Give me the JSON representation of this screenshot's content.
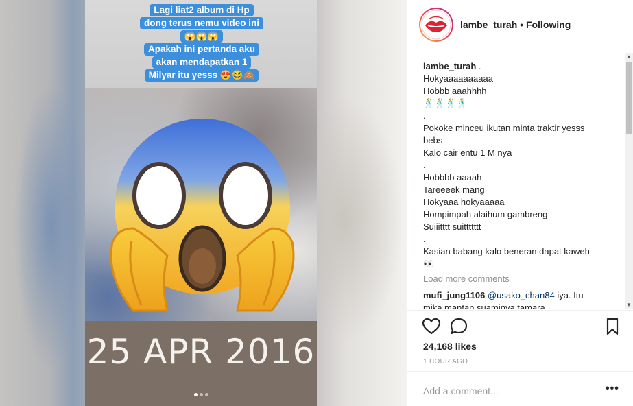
{
  "post": {
    "story": {
      "caption_lines": [
        "Lagi liat2 album di Hp",
        "dong terus nemu video ini",
        "😱😱😱",
        "Apakah ini pertanda aku",
        "akan mendapatkan 1",
        "Milyar itu yesss 😍😂🙈"
      ],
      "date_text": "25 APR 2016",
      "emoji_name": "scream-emoji"
    },
    "header": {
      "username": "lambe_turah",
      "separator": " • ",
      "follow_label": "Following"
    },
    "comments": {
      "owner": "lambe_turah",
      "caption_lines": [
        " .",
        "Hokyaaaaaaaaaa",
        "Hobbb aaahhhh",
        "🕺🕺🕺🕺",
        ".",
        "Pokoke minceu ikutan minta traktir yesss",
        "bebs",
        "Kalo cair entu 1 M nya",
        ".",
        "Hobbbb aaaah",
        "Tareeeek mang",
        "Hokyaaa hokyaaaaa",
        "Hompimpah alaihum gambreng",
        "Suiiitttt suittttttt",
        ".",
        "Kasian babang kalo beneran dapat kaweh",
        "👀"
      ],
      "load_more": "Load more comments",
      "reply": {
        "user": "mufi_jung1106",
        "mention": "@usako_chan84",
        "text": " iya. Itu",
        "text2": "mika mantan suaminya tamara"
      }
    },
    "likes": "24,168 likes",
    "time": "1 HOUR AGO",
    "add_comment_placeholder": "Add a comment...",
    "more_label": "•••",
    "colors": {
      "caption_bg": "#3b8fdc",
      "date_band": "#7c7066",
      "link": "#003569"
    }
  }
}
